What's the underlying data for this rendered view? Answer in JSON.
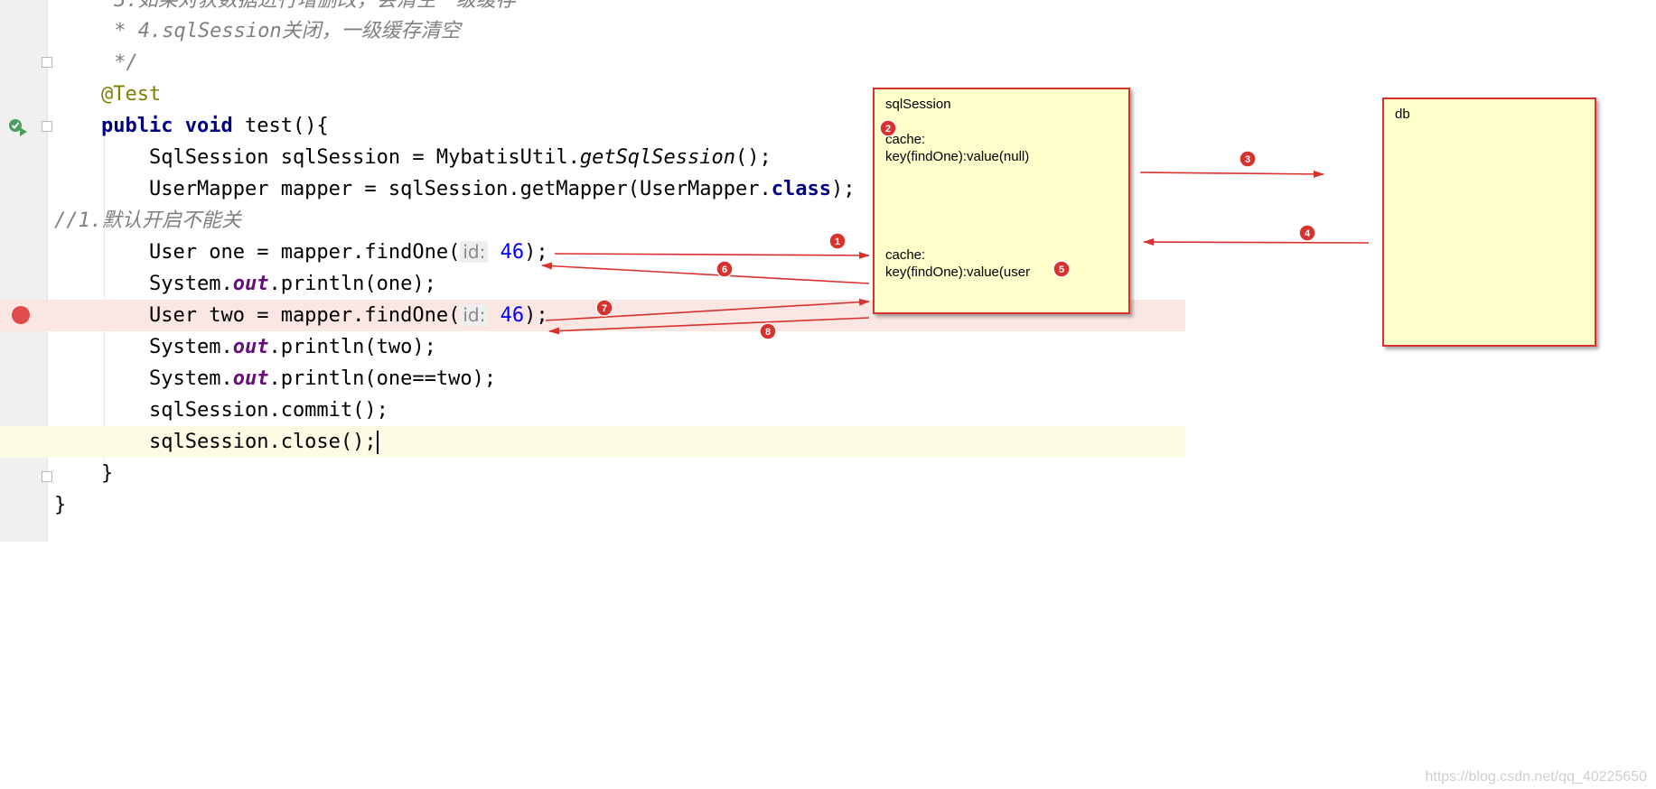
{
  "code": {
    "lines": [
      {
        "text": "     3.如果对获数据进行增删改，会清空一级缓存"
      },
      {
        "text": "     * 4.sqlSession关闭，一级缓存清空"
      },
      {
        "text": "     */"
      },
      {
        "annotation": "@Test"
      },
      {
        "kw1": "public",
        "kw2": "void",
        "rest": " test(){"
      },
      {
        "p1": "SqlSession sqlSession = MybatisUtil.",
        "method": "getSqlSession",
        "p2": "();"
      },
      {
        "p1": "UserMapper mapper = sqlSession.getMapper(UserMapper.",
        "kw": "class",
        "p2": ");"
      },
      {
        "text": "//1.默认开启不能关"
      },
      {
        "p1": "User one = mapper.findOne(",
        "hint": "id:",
        "num": "46",
        "p2": ");"
      },
      {
        "p1": "System.",
        "field": "out",
        "p2": ".println(one);"
      },
      {
        "p1": "User two = mapper.findOne(",
        "hint": "id:",
        "num": "46",
        "p2": ");"
      },
      {
        "p1": "System.",
        "field": "out",
        "p2": ".println(two);"
      },
      {
        "p1": "System.",
        "field": "out",
        "p2": ".println(one==two);"
      },
      {
        "text": "sqlSession.commit();"
      },
      {
        "text": "sqlSession.close();"
      },
      {
        "text": "}"
      },
      {
        "text": "}"
      }
    ]
  },
  "diagram": {
    "session_box": {
      "title": "sqlSession",
      "cache1_label": "cache:",
      "cache1_entry": "key(findOne):value(null)",
      "cache2_label": "cache:",
      "cache2_entry": "key(findOne):value(user"
    },
    "db_box": {
      "title": "db"
    },
    "step_labels": [
      "1",
      "2",
      "3",
      "4",
      "5",
      "6",
      "7",
      "8"
    ]
  },
  "watermark": "https://blog.csdn.net/qq_40225650",
  "colors": {
    "arrow": "#d8322f",
    "box_fill": "#ffffcc",
    "breakpoint": "#e04b4b"
  }
}
